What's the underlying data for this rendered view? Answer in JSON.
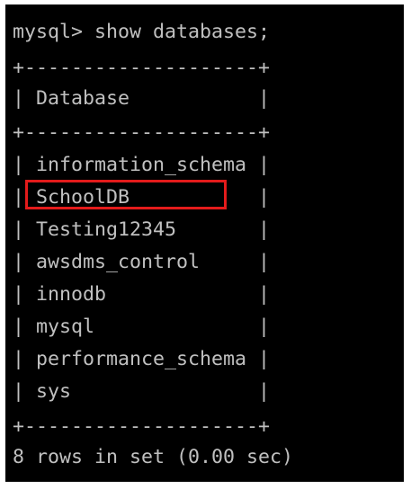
{
  "terminal": {
    "prompt_line": "mysql> show databases;",
    "border_top": "+--------------------+",
    "header_line": "| Database           |",
    "border_mid": "+--------------------+",
    "rows": [
      "| information_schema |",
      "| SchoolDB           |",
      "| Testing12345       |",
      "| awsdms_control     |",
      "| innodb             |",
      "| mysql              |",
      "| performance_schema |",
      "| sys                |"
    ],
    "border_bottom": "+--------------------+",
    "summary_line": "8 rows in set (0.00 sec)"
  },
  "colors": {
    "background": "#000000",
    "text": "#c0c0c0",
    "highlight": "#e31b1b"
  }
}
